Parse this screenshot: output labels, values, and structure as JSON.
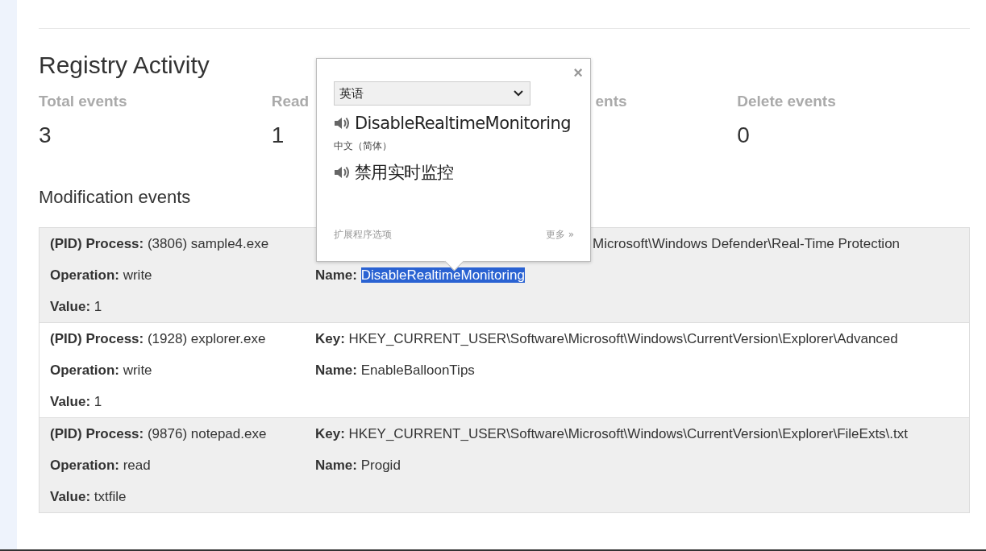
{
  "title": "Registry Activity",
  "stats": [
    {
      "label": "Total events",
      "value": "3"
    },
    {
      "label": "Read",
      "value": "1"
    },
    {
      "label": "ents",
      "covered": true
    },
    {
      "label": "Delete events",
      "value": "0"
    }
  ],
  "section_title": "Modification events",
  "events": [
    {
      "process_label": "(PID) Process:",
      "process": "(3806) sample4.exe",
      "key": "Microsoft\\Windows Defender\\Real-Time Protection",
      "operation_label": "Operation:",
      "operation": "write",
      "name_label": "Name:",
      "name": "DisableRealtimeMonitoring",
      "name_selected": true,
      "value_label": "Value:",
      "value": "1"
    },
    {
      "process_label": "(PID) Process:",
      "process": "(1928) explorer.exe",
      "key_label": "Key:",
      "key": "HKEY_CURRENT_USER\\Software\\Microsoft\\Windows\\CurrentVersion\\Explorer\\Advanced",
      "operation_label": "Operation:",
      "operation": "write",
      "name_label": "Name:",
      "name": "EnableBalloonTips",
      "name_selected": false,
      "value_label": "Value:",
      "value": "1"
    },
    {
      "process_label": "(PID) Process:",
      "process": "(9876) notepad.exe",
      "key_label": "Key:",
      "key": "HKEY_CURRENT_USER\\Software\\Microsoft\\Windows\\CurrentVersion\\Explorer\\FileExts\\.txt",
      "operation_label": "Operation:",
      "operation": "read",
      "name_label": "Name:",
      "name": "Progid",
      "name_selected": false,
      "value_label": "Value:",
      "value": "txtfile"
    }
  ],
  "translate_popup": {
    "close": "×",
    "source_language": "英语",
    "source_text": "DisableRealtimeMonitoring",
    "target_language": "中文（简体）",
    "target_text": "禁用实时监控",
    "options_link": "扩展程序选项",
    "more_link": "更多 »"
  }
}
